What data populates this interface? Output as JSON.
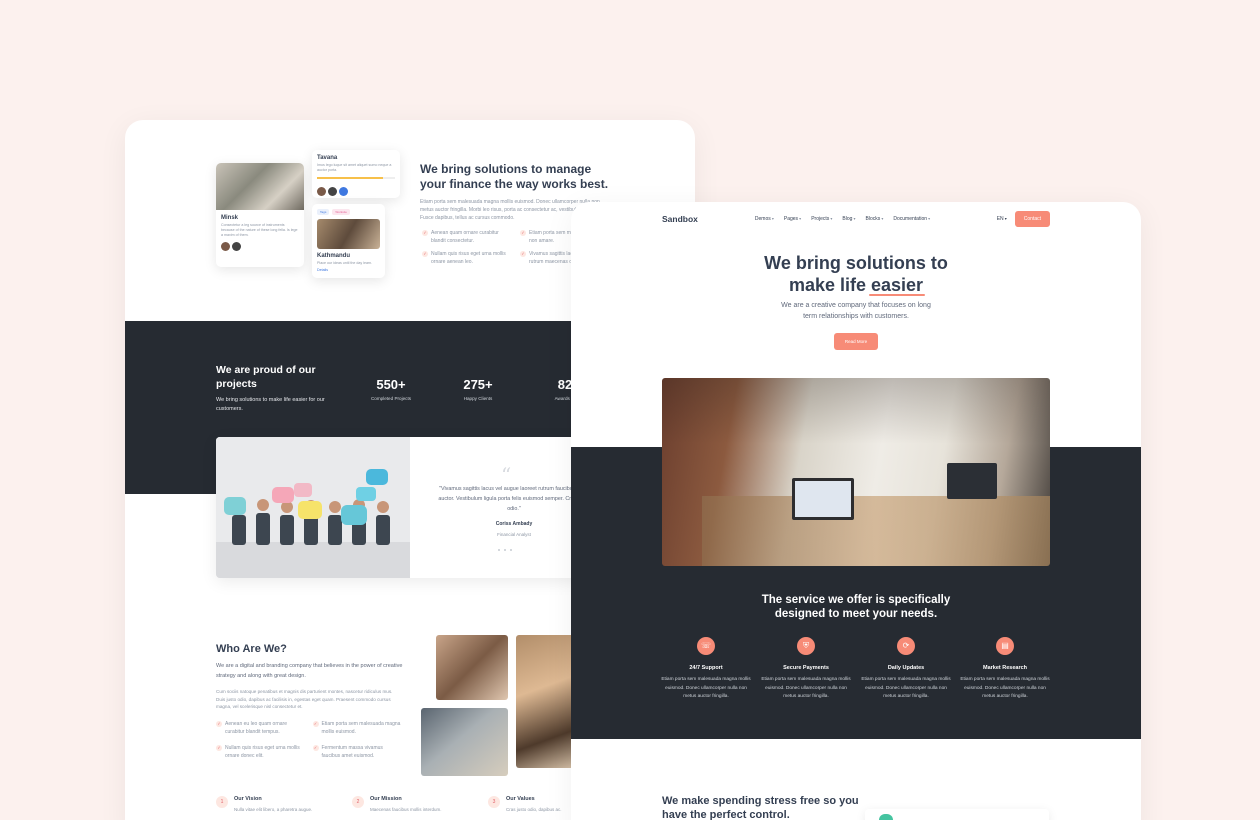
{
  "back": {
    "mini_cards": {
      "minsk": {
        "title": "Minsk",
        "text": "Consectetur a leg source of instruments because of the nature of these long fella. Is lege a maxim of them."
      },
      "tavana": {
        "title": "Tavana",
        "text": "Imus lego luque sit amet aliquet sumo neque a auctor porta."
      },
      "kathmandu": {
        "tag1": "Tags",
        "tag2": "Worksite",
        "title": "Kathmandu",
        "text": "Place our ideas until the day learn.",
        "link": "Details"
      }
    },
    "headline": "We bring solutions to manage your finance the way works best.",
    "paragraph": "Etiam porta sem malesuada magna mollis euismod. Donec ullamcorper nulla non metus auctor fringilla. Morbi leo risus, porta ac consectetur ac, vestibulum at eros. Fusce dapibus, tellus ac cursus commodo.",
    "bullets": [
      "Aenean quam ornare curabitur blandit consectetur.",
      "Etiam porta sem malesuada mollis non amare.",
      "Nullam quis risus eget urna mollis ornare aenean leo.",
      "Vivamus sagittis lacus vel augue rutrum maecenas odio."
    ],
    "proud_title": "We are proud of our projects",
    "proud_sub": "We bring solutions to make life easier for our customers.",
    "stats": [
      {
        "num": "550+",
        "label": "Completed Projects"
      },
      {
        "num": "275+",
        "label": "Happy Clients"
      },
      {
        "num": "82",
        "label": "Awards W"
      }
    ],
    "testimonial": {
      "quote": "\"Vivamus sagittis lacus vel augue laoreet rutrum faucibus dolor auctor. Vestibulum ligula porta felis euismod semper. Cras justo odio.\"",
      "name": "Coriss Ambady",
      "role": "Financial Analyst"
    },
    "who_title": "Who Are We?",
    "who_lead": "We are a digital and branding company that believes in the power of creative strategy and along with great design.",
    "who_body": "Cum sociis natoque penatibus et magnis dis parturient montes, nascetur ridiculus mus. Duis justo odio, dapibus ac facilisis in, egestas eget quam. Praesent commodo cursus magna, vel scelerisque nisl consectetur et.",
    "who_bullets": [
      "Aenean eu leo quam ornare curabitur blandit tempus.",
      "Etiam porta sem malesuada magna mollis euismod.",
      "Nullam quis risus eget urna mollis ornare donec elit.",
      "Fermentum massa vivamus faucibus amet euismod."
    ],
    "vmv": [
      {
        "num": "1",
        "title": "Our Vision",
        "desc": "Nulla vitae elit libero, a pharetra augue."
      },
      {
        "num": "2",
        "title": "Our Mission",
        "desc": "Maecenas faucibus mollis interdum."
      },
      {
        "num": "3",
        "title": "Our Values",
        "desc": "Cras justo odio, dapibus ac."
      }
    ]
  },
  "front": {
    "logo": "Sandbox",
    "menu": [
      "Demos",
      "Pages",
      "Projects",
      "Blog",
      "Blocks",
      "Documentation"
    ],
    "lang": "EN",
    "contact": "Contact",
    "hero_line1": "We bring solutions to",
    "hero_line2a": "make life ",
    "hero_line2b": "easier",
    "sub": "We are a creative company that focuses on long term relationships with customers.",
    "read_more": "Read More",
    "service_title": "The service we offer is specifically designed to meet your needs.",
    "features": [
      {
        "icon": "☏",
        "title": "24/7 Support",
        "desc": "Etiam porta sem malesuada magna mollis euismod. Donec ullamcorper nulla non metus auctor fringilla."
      },
      {
        "icon": "⛨",
        "title": "Secure Payments",
        "desc": "Etiam porta sem malesuada magna mollis euismod. Donec ullamcorper nulla non metus auctor fringilla."
      },
      {
        "icon": "⟳",
        "title": "Daily Updates",
        "desc": "Etiam porta sem malesuada magna mollis euismod. Donec ullamcorper nulla non metus auctor fringilla."
      },
      {
        "icon": "▤",
        "title": "Market Research",
        "desc": "Etiam porta sem malesuada magna mollis euismod. Donec ullamcorper nulla non metus auctor fringilla."
      }
    ],
    "spend_title": "We make spending stress free so you have the perfect control."
  },
  "colors": {
    "accent": "#f78b77",
    "dark": "#262b32",
    "background": "#fcf1ee"
  }
}
